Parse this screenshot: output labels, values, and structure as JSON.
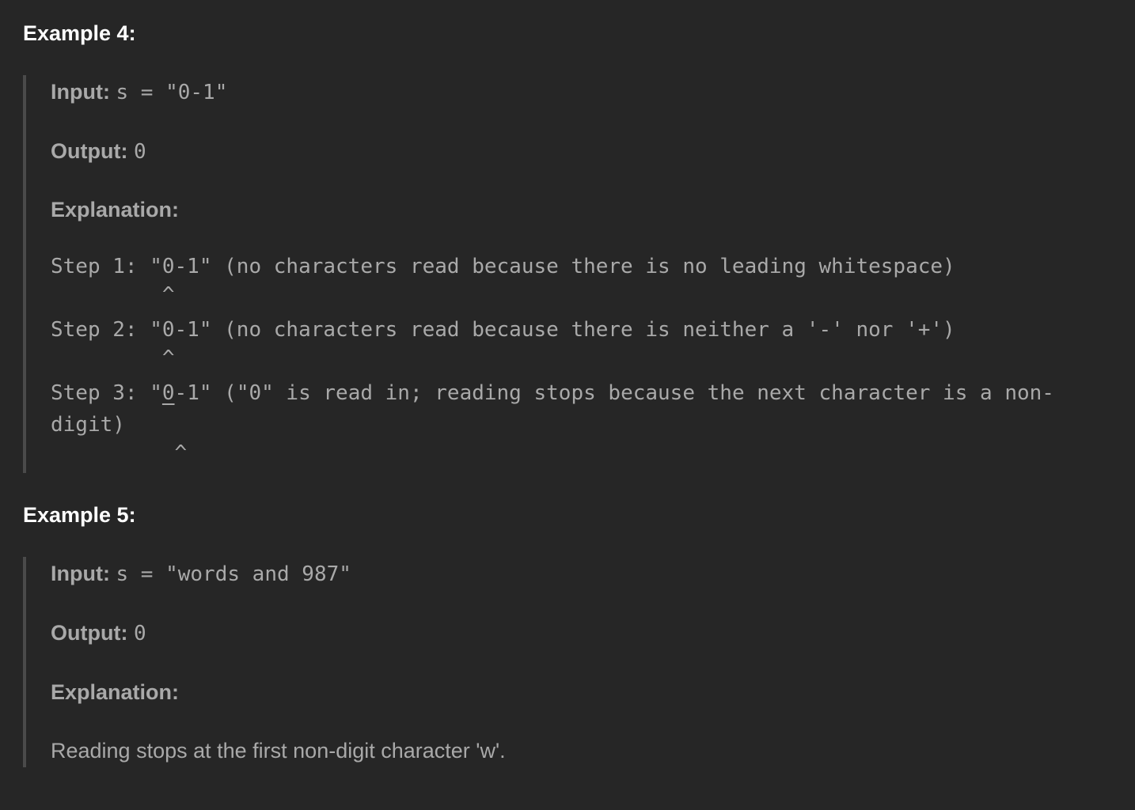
{
  "example4": {
    "heading": "Example 4:",
    "input_label": "Input:",
    "input_value": "s = \"0-1\"",
    "output_label": "Output:",
    "output_value": "0",
    "explanation_label": "Explanation:",
    "step1_line": "Step 1: \"0-1\" (no characters read because there is no leading whitespace)",
    "step1_caret": "         ^",
    "step2_line": "Step 2: \"0-1\" (no characters read because there is neither a '-' nor '+')",
    "step2_caret": "         ^",
    "step3_prefix": "Step 3: \"",
    "step3_underlined": "0",
    "step3_suffix": "-1\" (\"0\" is read in; reading stops because the next character is a non-",
    "step3_wrap": "digit)",
    "step3_caret": "          ^"
  },
  "example5": {
    "heading": "Example 5:",
    "input_label": "Input:",
    "input_value": "s = \"words and 987\"",
    "output_label": "Output:",
    "output_value": "0",
    "explanation_label": "Explanation:",
    "explanation_text": "Reading stops at the first non-digit character 'w'."
  }
}
